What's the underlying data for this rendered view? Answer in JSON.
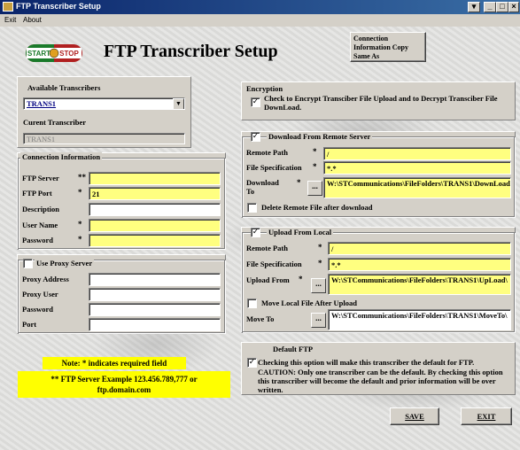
{
  "window": {
    "title": "FTP Transcriber Setup",
    "min": "_",
    "max": "□",
    "close": "×",
    "restore": "▾"
  },
  "menu": {
    "exit": "Exit",
    "about": "About"
  },
  "header": {
    "logo_left": "START",
    "logo_right": "STOP",
    "title": "FTP Transcriber Setup",
    "copy_button": "Connection Information Copy Same As"
  },
  "transcribers": {
    "available_label": "Available Transcribers",
    "available_value": "TRANS1",
    "current_label": "Curent Transcriber",
    "current_value": "TRANS1"
  },
  "connection": {
    "group_label": "Connection Information",
    "ftp_server_label": "FTP Server",
    "ftp_server_req": "**",
    "ftp_server_value": "",
    "ftp_port_label": "FTP Port",
    "ftp_port_req": "*",
    "ftp_port_value": "21",
    "description_label": "Description",
    "description_value": "",
    "user_label": "User Name",
    "user_req": "*",
    "user_value": "",
    "password_label": "Password",
    "password_req": "*",
    "password_value": ""
  },
  "proxy": {
    "checkbox_label": "Use Proxy Server",
    "checked": "",
    "address_label": "Proxy Address",
    "user_label": "Proxy User",
    "password_label": "Password",
    "port_label": "Port"
  },
  "notes": {
    "required": "Note: * indicates required field",
    "example_line1": "** FTP Server Example 123.456.789,777 or",
    "example_line2": "ftp.domain.com"
  },
  "encryption": {
    "group_label": "Encryption",
    "checked": "✓",
    "checkbox_label": "Check to Encrypt Transciber File Upload and to Decrypt Transciber File  DownLoad."
  },
  "download": {
    "checked": "✓",
    "group_label": "Download From Remote Server",
    "remote_path_label": "Remote Path",
    "remote_path_req": "*",
    "remote_path_value": "/",
    "file_spec_label": "File Specification",
    "file_spec_req": "*",
    "file_spec_value": "*.*",
    "download_to_label_1": "Download",
    "download_to_label_2": "To",
    "download_to_req": "*",
    "browse": "...",
    "download_to_value": "W:\\STCommunications\\FileFolders\\TRANS1\\DownLoad\\",
    "delete_checked": "",
    "delete_label": "Delete Remote File after download"
  },
  "upload": {
    "checked": "✓",
    "group_label": "Upload From Local",
    "remote_path_label": "Remote Path",
    "remote_path_req": "*",
    "remote_path_value": "/",
    "file_spec_label": "File Specification",
    "file_spec_req": "*",
    "file_spec_value": "*.*",
    "upload_from_label": "Upload From",
    "upload_from_req": "*",
    "browse": "...",
    "upload_from_value": "W:\\STCommunications\\FileFolders\\TRANS1\\UpLoad\\",
    "move_checked": "",
    "move_label": "Move Local File After Upload",
    "move_to_label": "Move To",
    "move_to_browse": "...",
    "move_to_value": "W:\\STCommunications\\FileFolders\\TRANS1\\MoveTo\\"
  },
  "default_ftp": {
    "group_label": "Default FTP",
    "checked": "✓",
    "checkbox_label": "Checking this option will make this transcriber the default for FTP.",
    "caution": "CAUTION: Only one transcriber can be the default.  By checking this option  this transcriber will become the default and prior information will be over written."
  },
  "buttons": {
    "save": "SAVE",
    "exit": "EXIT"
  }
}
